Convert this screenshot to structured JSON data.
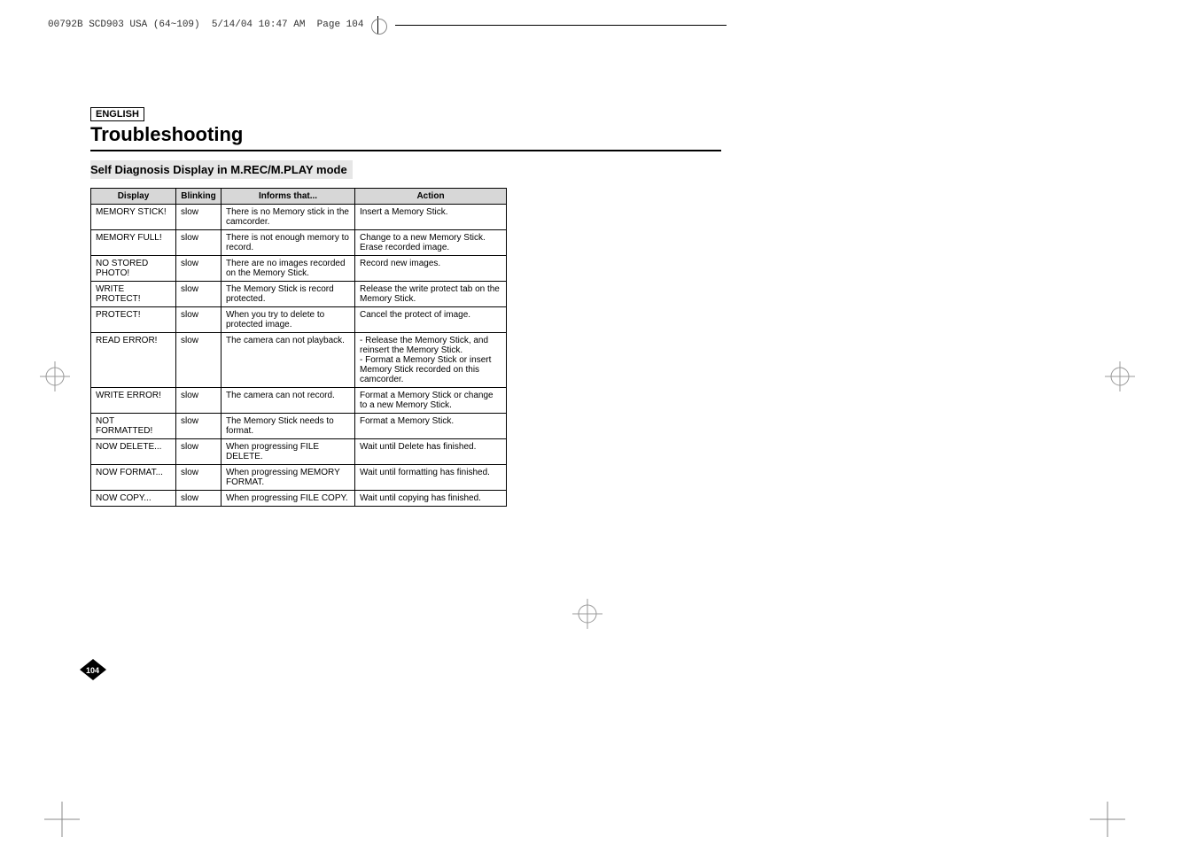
{
  "header": {
    "file_info": "00792B SCD903 USA (64~109)  5/14/04 10:47 AM  Page 104"
  },
  "lang_label": "ENGLISH",
  "title": "Troubleshooting",
  "subtitle": "Self Diagnosis Display in M.REC/M.PLAY mode",
  "page_number": "104",
  "table": {
    "headers": {
      "display": "Display",
      "blinking": "Blinking",
      "informs": "Informs that...",
      "action": "Action"
    },
    "rows": [
      {
        "display": "MEMORY STICK!",
        "blinking": "slow",
        "informs": "There is no Memory stick in the camcorder.",
        "action": "Insert a Memory Stick."
      },
      {
        "display": "MEMORY FULL!",
        "blinking": "slow",
        "informs": "There is not enough memory to record.",
        "action": "Change to a new Memory Stick. Erase recorded image."
      },
      {
        "display": "NO STORED PHOTO!",
        "blinking": "slow",
        "informs": "There are no images recorded on the Memory Stick.",
        "action": "Record new images."
      },
      {
        "display": "WRITE PROTECT!",
        "blinking": "slow",
        "informs": "The Memory Stick is record protected.",
        "action": "Release the write protect tab on the Memory Stick."
      },
      {
        "display": "PROTECT!",
        "blinking": "slow",
        "informs": "When you try to delete to protected image.",
        "action": "Cancel the protect of image."
      },
      {
        "display": "READ ERROR!",
        "blinking": "slow",
        "informs": "The camera can not playback.",
        "action": "- Release the Memory Stick, and reinsert the Memory Stick.\n- Format a Memory Stick or insert Memory Stick recorded on this camcorder."
      },
      {
        "display": "WRITE ERROR!",
        "blinking": "slow",
        "informs": "The camera can not record.",
        "action": "Format a Memory Stick or change to a new Memory Stick."
      },
      {
        "display": "NOT FORMATTED!",
        "blinking": "slow",
        "informs": "The  Memory Stick needs to format.",
        "action": "Format a Memory Stick."
      },
      {
        "display": "NOW DELETE...",
        "blinking": "slow",
        "informs": "When progressing FILE DELETE.",
        "action": "Wait until Delete has finished."
      },
      {
        "display": "NOW FORMAT...",
        "blinking": "slow",
        "informs": "When progressing MEMORY FORMAT.",
        "action": "Wait until formatting has finished."
      },
      {
        "display": "NOW COPY...",
        "blinking": "slow",
        "informs": "When progressing FILE COPY.",
        "action": "Wait until copying has finished."
      }
    ]
  }
}
